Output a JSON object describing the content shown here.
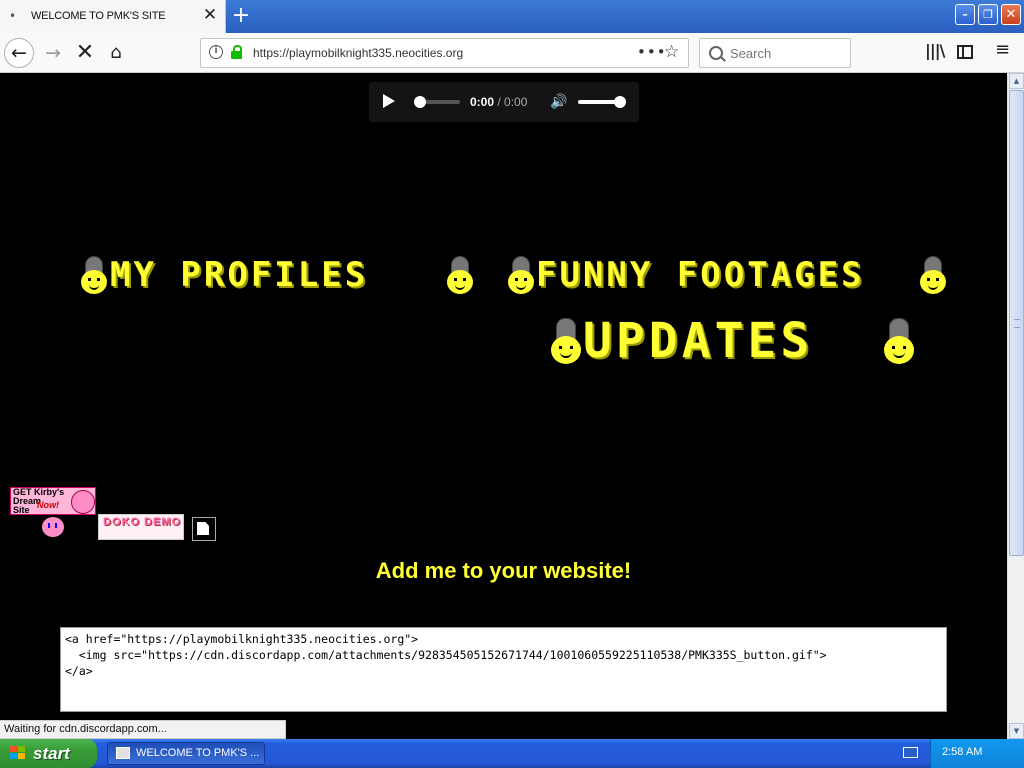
{
  "browser": {
    "tab_title": "WELCOME TO PMK'S SITE",
    "tab_close": "✕",
    "new_tab": "+",
    "url": "https://playmobilknight335.neocities.org",
    "search_placeholder": "Search",
    "page_actions": "•••",
    "bookmark_star": "☆",
    "library": "|||\\",
    "menu": "≡"
  },
  "window_controls": {
    "minimize": "–",
    "maximize": "❐",
    "close": "✕"
  },
  "audio_player": {
    "current_time": "0:00",
    "separator": " / ",
    "duration": "0:00",
    "progress": 0,
    "volume": 1.0
  },
  "nav_links": [
    {
      "label": "MY PROFILES"
    },
    {
      "label": "FUNNY FOOTAGES"
    },
    {
      "label": "UPDATES"
    }
  ],
  "buttons88": {
    "kirby_line1": "GET Kirby's",
    "kirby_line2": "Dream",
    "kirby_line3": "Site",
    "kirby_now": "Now!",
    "dotdemo": "DOKO DEMO"
  },
  "embed": {
    "heading": "Add me to your website!",
    "code": "<a href=\"https://playmobilknight335.neocities.org\">\n  <img src=\"https://cdn.discordapp.com/attachments/928354505152671744/1001060559225110538/PMK335S_button.gif\">\n</a>"
  },
  "status_text": "Waiting for cdn.discordapp.com...",
  "taskbar": {
    "start_label": "start",
    "task_title": "WELCOME TO PMK'S ...",
    "clock": "2:58 AM"
  },
  "colors": {
    "accent_yellow": "#ffff33",
    "tab_bar_blue": "#2a5fbf",
    "xp_start_green": "#389b38"
  }
}
